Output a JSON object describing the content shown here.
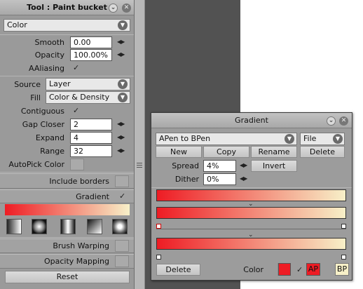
{
  "tool_panel": {
    "title": "Tool : Paint bucket",
    "mode_dropdown": "Color",
    "smooth_label": "Smooth",
    "smooth_value": "0.00",
    "opacity_label": "Opacity",
    "opacity_value": "100.00%",
    "aaliasing_label": "AAliasing",
    "source_label": "Source",
    "source_value": "Layer",
    "fill_label": "Fill",
    "fill_value": "Color & Density",
    "contiguous_label": "Contiguous",
    "gap_closer_label": "Gap Closer",
    "gap_closer_value": "2",
    "expand_label": "Expand",
    "expand_value": "4",
    "range_label": "Range",
    "range_value": "32",
    "autopick_label": "AutoPick Color",
    "include_borders_label": "Include borders",
    "gradient_label": "Gradient",
    "brush_warping_label": "Brush Warping",
    "opacity_mapping_label": "Opacity Mapping",
    "reset_label": "Reset",
    "gradient_shapes": [
      "linear-gradient-icon",
      "radial-gradient-icon",
      "reflected-gradient-icon",
      "diamond-gradient-icon",
      "square-gradient-icon"
    ]
  },
  "gradient_window": {
    "title": "Gradient",
    "preset_value": "APen to BPen",
    "file_label": "File",
    "new_label": "New",
    "copy_label": "Copy",
    "rename_label": "Rename",
    "delete_label": "Delete",
    "spread_label": "Spread",
    "spread_value": "4%",
    "invert_label": "Invert",
    "dither_label": "Dither",
    "dither_value": "0%",
    "bottom_delete_label": "Delete",
    "color_label": "Color",
    "ap_label": "AP",
    "bp_label": "BP"
  },
  "colors": {
    "gradient_start": "#ee1c24",
    "gradient_end": "#f7f0c8",
    "selected_color": "#ee1c24"
  }
}
